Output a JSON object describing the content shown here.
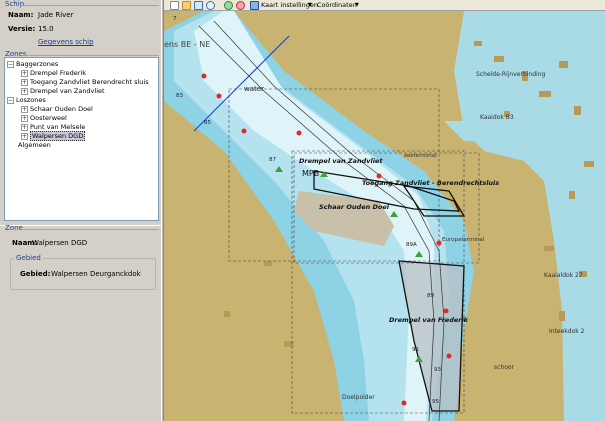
{
  "schip": {
    "group_title": "Schip",
    "naam_label": "Naam:",
    "naam_value": "Jade River",
    "versie_label": "Versie:",
    "versie_value": "15.0",
    "link": "Gegevens schip"
  },
  "zones": {
    "group_title": "Zones",
    "tree": [
      {
        "label": "Baggerzones",
        "level": 0,
        "expander": "−"
      },
      {
        "label": "Drempel Frederik",
        "level": 1,
        "expander": "+"
      },
      {
        "label": "Toegang Zandvliet Berendrecht sluis",
        "level": 1,
        "expander": "+"
      },
      {
        "label": "Drempel van Zandvliet",
        "level": 1,
        "expander": "+"
      },
      {
        "label": "Loszones",
        "level": 0,
        "expander": "−"
      },
      {
        "label": "Schaar Ouden Doel",
        "level": 1,
        "expander": "+"
      },
      {
        "label": "Oosterweel",
        "level": 1,
        "expander": "+"
      },
      {
        "label": "Punt van Melsele",
        "level": 1,
        "expander": "+"
      },
      {
        "label": "Walpersen DGD",
        "level": 1,
        "expander": "+",
        "selected": true
      },
      {
        "label": "Algemeen",
        "level": 0,
        "expander": ""
      }
    ]
  },
  "zone": {
    "group_title": "Zone",
    "naam_label": "Naam:",
    "naam_value": "Walpersen DGD",
    "gebied_title": "Gebied",
    "gebied_label": "Gebied:",
    "gebied_value": "Walpersen Deurganckdok"
  },
  "toolbar": {
    "kaart_label": "Kaart instellingen",
    "coord_label": "Coördinaten"
  },
  "map": {
    "colors": {
      "land": "#c8b370",
      "water_shallow": "#8ed2e6",
      "water_mid": "#aee0ee",
      "water_deep": "#d8f2f6",
      "inland_water": "#9ed6e6",
      "building": "#b89a58",
      "zone_fill": "#b8c0c4"
    },
    "labels": {
      "region_top": "ens BE - NE",
      "scheldt": "Schelde-Rijnverbinding",
      "water": "water",
      "kaaidok": "Kaaidok B3",
      "zand_lbl": "Drempel van Zandvliet",
      "mpb": "MPB",
      "toegang_lbl": "Toegang Zandvliet - Berendrechtsluis",
      "schaar_lbl": "Schaar Ouden Doel",
      "frederik_lbl": "Drempel van Frederik",
      "kaaialdok": "Kaaialdok 27",
      "inteekdok": "Inteekdok 2",
      "doelpolder": "Doelpolder",
      "schoor": "schoor",
      "europaterminal": "Europaterminal",
      "zeeterminal": "zeeterminal"
    },
    "buoy_numbers": [
      "7",
      "83",
      "85",
      "87",
      "89A",
      "89",
      "91",
      "93",
      "95"
    ]
  }
}
